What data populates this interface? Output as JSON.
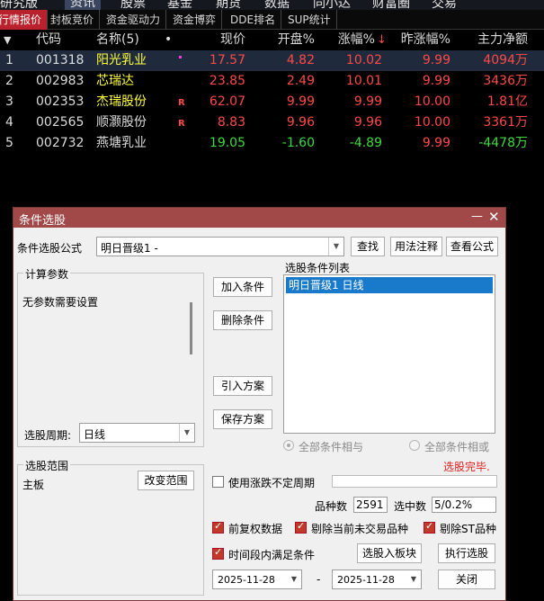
{
  "topmenu": {
    "items": [
      "研究版",
      "资讯",
      "股票",
      "基金",
      "期货",
      "数据",
      "同小达",
      "财富圈",
      "交易"
    ],
    "active": 1
  },
  "tabs": {
    "items": [
      "行情报价",
      "封板竞价",
      "资金驱动力",
      "资金博弈",
      "DDE排名",
      "SUP统计"
    ],
    "active": 0
  },
  "table": {
    "headers": {
      "arrow": "▼",
      "code": "代码",
      "name": "名称(5)",
      "dot": "•",
      "price": "现价",
      "open_pct": "开盘%",
      "change_pct": "涨幅%",
      "sort_arrow": "↓",
      "prev_change_pct": "昨涨幅%",
      "net_inflow": "主力净额"
    },
    "rows": [
      {
        "idx": "1",
        "code": "001318",
        "name": "阳光乳业",
        "mark": "",
        "price": "17.57",
        "open_pct": "4.82",
        "change_pct": "10.02",
        "prev_change_pct": "9.99",
        "net_inflow": "4094万"
      },
      {
        "idx": "2",
        "code": "002983",
        "name": "芯瑞达",
        "mark": "",
        "price": "23.85",
        "open_pct": "2.49",
        "change_pct": "10.01",
        "prev_change_pct": "9.99",
        "net_inflow": "3436万"
      },
      {
        "idx": "3",
        "code": "002353",
        "name": "杰瑞股份",
        "mark": "R",
        "price": "62.07",
        "open_pct": "9.99",
        "change_pct": "9.99",
        "prev_change_pct": "10.00",
        "net_inflow": "1.81亿"
      },
      {
        "idx": "4",
        "code": "002565",
        "name": "顺灏股份",
        "mark": "R",
        "price": "8.83",
        "open_pct": "9.96",
        "change_pct": "9.96",
        "prev_change_pct": "10.00",
        "net_inflow": "3361万"
      },
      {
        "idx": "5",
        "code": "002732",
        "name": "燕塘乳业",
        "mark": "",
        "price": "19.05",
        "open_pct": "-1.60",
        "change_pct": "-4.89",
        "prev_change_pct": "9.99",
        "net_inflow": "-4478万"
      }
    ]
  },
  "dialog": {
    "title": "条件选股",
    "min_label": "—",
    "close_label": "✕",
    "formula_label": "条件选股公式",
    "formula_value": "明日晋级1  -",
    "find_button": "查找",
    "usage_button": "用法注释",
    "view_formula_button": "查看公式",
    "params_group": "计算参数",
    "params_text": "无参数需要设置",
    "period_label": "选股周期:",
    "period_value": "日线",
    "add_condition": "加入条件",
    "delete_condition": "删除条件",
    "import_plan": "引入方案",
    "save_plan": "保存方案",
    "condition_list_label": "选股条件列表",
    "condition_list": [
      "明日晋级1  日线"
    ],
    "radio_and": "全部条件相与",
    "radio_or": "全部条件相或",
    "status_text": "选股完毕.",
    "range_group": "选股范围",
    "range_value": "主板",
    "change_range": "改变范围",
    "uncertain_period": "使用涨跌不定周期",
    "count_label": "品种数",
    "count_value": "2591",
    "selected_label": "选中数",
    "selected_value": "5/0.2%",
    "fq_data": "前复权数据",
    "exclude_untraded": "剔除当前未交易品种",
    "exclude_st": "剔除ST品种",
    "time_range": "时间段内满足条件",
    "add_to_block": "选股入板块",
    "execute": "执行选股",
    "date_from": "2025-11-28",
    "date_sep": "-",
    "date_to": "2025-11-28",
    "close": "关闭"
  },
  "colors": {
    "up": "#ff4848",
    "down": "#3ddc3d",
    "tab_active": "#b9222c",
    "dialog_title": "#a14848",
    "list_select": "#1979ca"
  }
}
